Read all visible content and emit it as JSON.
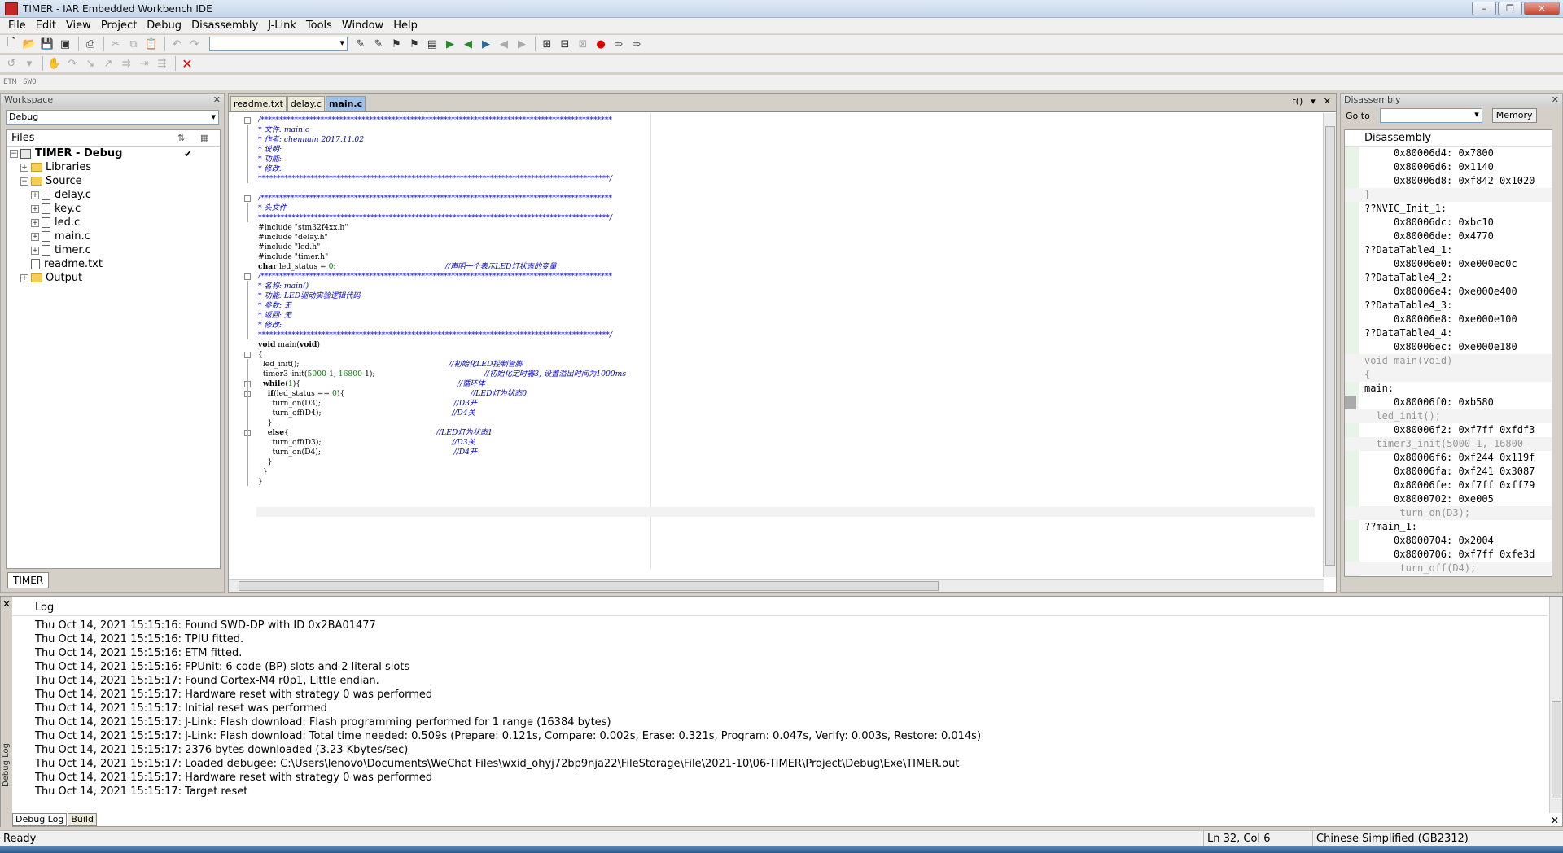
{
  "window": {
    "title": "TIMER - IAR Embedded Workbench IDE"
  },
  "menu": [
    "File",
    "Edit",
    "View",
    "Project",
    "Debug",
    "Disassembly",
    "J-Link",
    "Tools",
    "Window",
    "Help"
  ],
  "toolbar": {
    "tiny_labels": [
      "ETM",
      "SWO"
    ]
  },
  "workspace": {
    "header": "Workspace",
    "config": "Debug",
    "files_header": "Files",
    "tree": [
      {
        "label": "TIMER - Debug",
        "depth": 0,
        "type": "project",
        "bold": true
      },
      {
        "label": "Libraries",
        "depth": 1,
        "type": "folder"
      },
      {
        "label": "Source",
        "depth": 1,
        "type": "folder"
      },
      {
        "label": "delay.c",
        "depth": 2,
        "type": "file"
      },
      {
        "label": "key.c",
        "depth": 2,
        "type": "file"
      },
      {
        "label": "led.c",
        "depth": 2,
        "type": "file"
      },
      {
        "label": "main.c",
        "depth": 2,
        "type": "file"
      },
      {
        "label": "timer.c",
        "depth": 2,
        "type": "file"
      },
      {
        "label": "readme.txt",
        "depth": 1,
        "type": "file"
      },
      {
        "label": "Output",
        "depth": 1,
        "type": "folder"
      }
    ],
    "tab": "TIMER"
  },
  "editor": {
    "tabs": [
      "readme.txt",
      "delay.c",
      "main.c"
    ],
    "active_tab": "main.c",
    "func_label": "f()",
    "lines": [
      [
        [
          "c",
          "/**********************************************************************************************"
        ]
      ],
      [
        [
          "c",
          "* 文件: main.c"
        ]
      ],
      [
        [
          "c",
          "* 作者: chennain 2017.11.02"
        ]
      ],
      [
        [
          "c",
          "* 说明:"
        ]
      ],
      [
        [
          "c",
          "* 功能:"
        ]
      ],
      [
        [
          "c",
          "* 修改:"
        ]
      ],
      [
        [
          "c",
          "**********************************************************************************************/"
        ]
      ],
      [
        [
          "p",
          ""
        ]
      ],
      [
        [
          "c",
          "/**********************************************************************************************"
        ]
      ],
      [
        [
          "c",
          "* 头文件"
        ]
      ],
      [
        [
          "c",
          "**********************************************************************************************/"
        ]
      ],
      [
        [
          "p",
          "#include \"stm32f4xx.h\""
        ]
      ],
      [
        [
          "p",
          "#include \"delay.h\""
        ]
      ],
      [
        [
          "p",
          "#include \"led.h\""
        ]
      ],
      [
        [
          "p",
          "#include \"timer.h\""
        ]
      ],
      [
        [
          "k",
          "char"
        ],
        [
          "p",
          " led_status = "
        ],
        [
          "n",
          "0"
        ],
        [
          "p",
          ";                                              "
        ],
        [
          "c",
          "//声明一个表示LED灯状态的变量"
        ]
      ],
      [
        [
          "c",
          "/**********************************************************************************************"
        ]
      ],
      [
        [
          "c",
          "* 名称: main()"
        ]
      ],
      [
        [
          "c",
          "* 功能: LED驱动实验逻辑代码"
        ]
      ],
      [
        [
          "c",
          "* 参数: 无"
        ]
      ],
      [
        [
          "c",
          "* 返回: 无"
        ]
      ],
      [
        [
          "c",
          "* 修改:"
        ]
      ],
      [
        [
          "c",
          "**********************************************************************************************/"
        ]
      ],
      [
        [
          "k",
          "void"
        ],
        [
          "p",
          " main("
        ],
        [
          "k",
          "void"
        ],
        [
          "p",
          ")"
        ]
      ],
      [
        [
          "p",
          "{"
        ]
      ],
      [
        [
          "p",
          "  led_init();                                                               "
        ],
        [
          "c",
          "//初始化LED控制管脚"
        ]
      ],
      [
        [
          "p",
          "  timer3_init("
        ],
        [
          "n",
          "5000"
        ],
        [
          "p",
          "-1, "
        ],
        [
          "n",
          "16800"
        ],
        [
          "p",
          "-1);                                              "
        ],
        [
          "c",
          "//初始化定时器3, 设置溢出时间为1000ms"
        ]
      ],
      [
        [
          "p",
          "  "
        ],
        [
          "k",
          "while"
        ],
        [
          "p",
          "("
        ],
        [
          "n",
          "1"
        ],
        [
          "p",
          "){                                                                  "
        ],
        [
          "c",
          "//循环体"
        ]
      ],
      [
        [
          "p",
          "    "
        ],
        [
          "k",
          "if"
        ],
        [
          "p",
          "(led_status == "
        ],
        [
          "n",
          "0"
        ],
        [
          "p",
          "){                                                     "
        ],
        [
          "c",
          "//LED灯为状态0"
        ]
      ],
      [
        [
          "p",
          "      turn_on(D3);                                                        "
        ],
        [
          "c",
          "//D3开"
        ]
      ],
      [
        [
          "p",
          "      turn_off(D4);                                                       "
        ],
        [
          "c",
          "//D4关"
        ]
      ],
      [
        [
          "p",
          "    }"
        ]
      ],
      [
        [
          "p",
          "    "
        ],
        [
          "k",
          "else"
        ],
        [
          "p",
          "{                                                              "
        ],
        [
          "c",
          "//LED灯为状态1"
        ]
      ],
      [
        [
          "p",
          "      turn_off(D3);                                                       "
        ],
        [
          "c",
          "//D3关"
        ]
      ],
      [
        [
          "p",
          "      turn_on(D4);                                                        "
        ],
        [
          "c",
          "//D4开"
        ]
      ],
      [
        [
          "p",
          "    }"
        ]
      ],
      [
        [
          "p",
          "  }"
        ]
      ],
      [
        [
          "p",
          "}"
        ]
      ]
    ]
  },
  "disassembly": {
    "header": "Disassembly",
    "goto_label": "Go to",
    "memory_button": "Memory",
    "view_title": "Disassembly",
    "lines": [
      {
        "t": "ins",
        "text": "0x80006d4: 0x7800"
      },
      {
        "t": "ins",
        "text": "0x80006d6: 0x1140"
      },
      {
        "t": "ins",
        "text": "0x80006d8: 0xf842 0x1020"
      },
      {
        "t": "src",
        "text": "}"
      },
      {
        "t": "lab",
        "text": "??NVIC_Init_1:"
      },
      {
        "t": "ins",
        "text": "0x80006dc: 0xbc10"
      },
      {
        "t": "ins",
        "text": "0x80006de: 0x4770"
      },
      {
        "t": "lab",
        "text": "??DataTable4_1:"
      },
      {
        "t": "ins",
        "text": "0x80006e0: 0xe000ed0c"
      },
      {
        "t": "lab",
        "text": "??DataTable4_2:"
      },
      {
        "t": "ins",
        "text": "0x80006e4: 0xe000e400"
      },
      {
        "t": "lab",
        "text": "??DataTable4_3:"
      },
      {
        "t": "ins",
        "text": "0x80006e8: 0xe000e100"
      },
      {
        "t": "lab",
        "text": "??DataTable4_4:"
      },
      {
        "t": "ins",
        "text": "0x80006ec: 0xe000e180"
      },
      {
        "t": "src",
        "text": "void main(void)"
      },
      {
        "t": "src",
        "text": "{"
      },
      {
        "t": "lab",
        "text": "main:"
      },
      {
        "t": "ins",
        "text": "0x80006f0: 0xb580",
        "hl": true
      },
      {
        "t": "src",
        "text": "  led_init();"
      },
      {
        "t": "ins",
        "text": "0x80006f2: 0xf7ff 0xfdf3"
      },
      {
        "t": "src",
        "text": "  timer3_init(5000-1, 16800-"
      },
      {
        "t": "ins",
        "text": "0x80006f6: 0xf244 0x119f"
      },
      {
        "t": "ins",
        "text": "0x80006fa: 0xf241 0x3087"
      },
      {
        "t": "ins",
        "text": "0x80006fe: 0xf7ff 0xff79"
      },
      {
        "t": "ins",
        "text": "0x8000702: 0xe005"
      },
      {
        "t": "src",
        "text": "      turn_on(D3);"
      },
      {
        "t": "lab",
        "text": "??main_1:"
      },
      {
        "t": "ins",
        "text": "0x8000704: 0x2004"
      },
      {
        "t": "ins",
        "text": "0x8000706: 0xf7ff 0xfe3d"
      },
      {
        "t": "src",
        "text": "      turn_off(D4);"
      }
    ]
  },
  "log": {
    "header": "Log",
    "side_label": "Debug Log",
    "tabs": [
      "Debug Log",
      "Build"
    ],
    "lines": [
      "Thu Oct 14, 2021 15:15:16: Found SWD-DP with ID 0x2BA01477",
      "Thu Oct 14, 2021 15:15:16: TPIU fitted.",
      "Thu Oct 14, 2021 15:15:16: ETM fitted.",
      "Thu Oct 14, 2021 15:15:16: FPUnit: 6 code (BP) slots and 2 literal slots",
      "Thu Oct 14, 2021 15:15:17: Found Cortex-M4 r0p1, Little endian.",
      "Thu Oct 14, 2021 15:15:17: Hardware reset with strategy 0 was performed",
      "Thu Oct 14, 2021 15:15:17: Initial reset was performed",
      "Thu Oct 14, 2021 15:15:17: J-Link: Flash download: Flash programming performed for 1 range (16384 bytes)",
      "Thu Oct 14, 2021 15:15:17: J-Link: Flash download: Total time needed: 0.509s (Prepare: 0.121s, Compare: 0.002s, Erase: 0.321s, Program: 0.047s, Verify: 0.003s, Restore: 0.014s)",
      "Thu Oct 14, 2021 15:15:17: 2376 bytes downloaded (3.23 Kbytes/sec)",
      "Thu Oct 14, 2021 15:15:17: Loaded debugee: C:\\Users\\lenovo\\Documents\\WeChat Files\\wxid_ohyj72bp9nja22\\FileStorage\\File\\2021-10\\06-TIMER\\Project\\Debug\\Exe\\TIMER.out",
      "Thu Oct 14, 2021 15:15:17: Hardware reset with strategy 0 was performed",
      "Thu Oct 14, 2021 15:15:17: Target reset"
    ]
  },
  "status": {
    "ready": "Ready",
    "position": "Ln 32, Col 6",
    "language": "Chinese Simplified (GB2312)"
  }
}
